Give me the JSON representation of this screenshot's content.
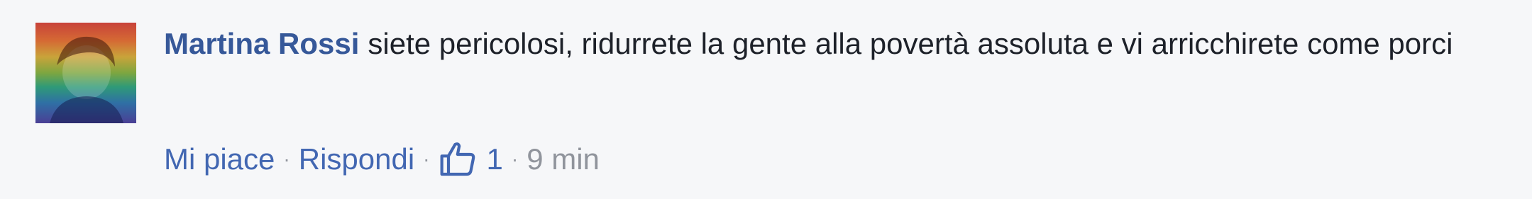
{
  "comment": {
    "author": "Martina Rossi",
    "text": "siete pericolosi, ridurrete la gente alla povertà assoluta e vi arricchirete come porci",
    "actions": {
      "like_label": "Mi piace",
      "reply_label": "Rispondi",
      "separator": "·",
      "like_count": "1",
      "timestamp": "9 min"
    }
  },
  "icons": {
    "like": "thumbs-up-icon"
  },
  "colors": {
    "author": "#365899",
    "link": "#4267b2",
    "muted": "#90949c",
    "text": "#1d2129",
    "background": "#f6f7f9"
  }
}
